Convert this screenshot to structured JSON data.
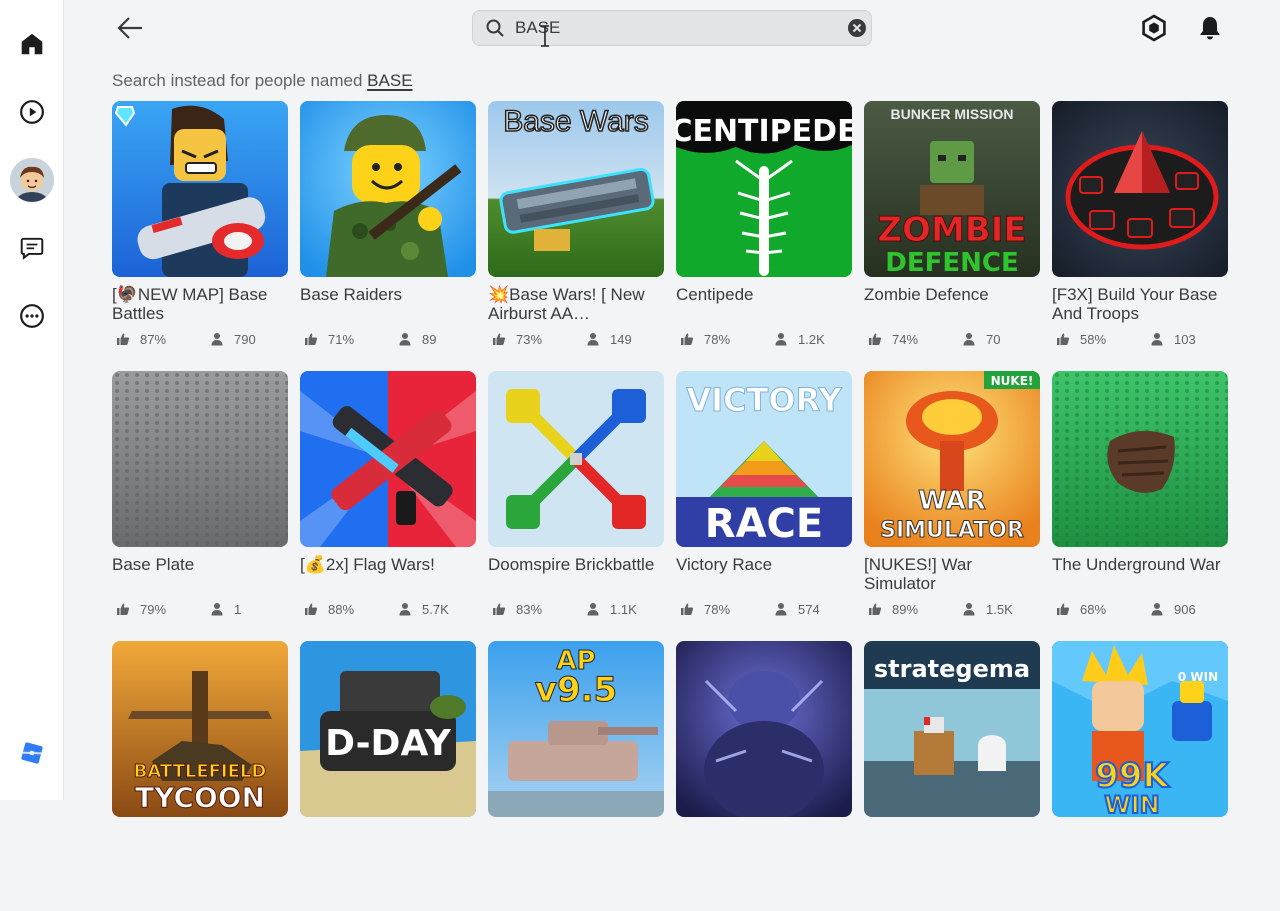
{
  "sidebar": {
    "items": [
      {
        "name": "home-icon"
      },
      {
        "name": "discover-icon"
      },
      {
        "name": "avatar"
      },
      {
        "name": "chat-icon"
      },
      {
        "name": "more-icon"
      }
    ],
    "logo": "roblox-logo"
  },
  "search": {
    "value": "BASE",
    "placeholder": "Search"
  },
  "suggestion": {
    "prefix": "Search instead for people named ",
    "name": "BASE"
  },
  "colors": {
    "accent": "#393b3d",
    "background": "#f2f4f5"
  },
  "games": [
    {
      "title": "[🦃NEW MAP] Base Battles",
      "rating": "87%",
      "players": "790"
    },
    {
      "title": "Base Raiders",
      "rating": "71%",
      "players": "89"
    },
    {
      "title": "💥Base Wars! [ New Airburst AA…",
      "rating": "73%",
      "players": "149"
    },
    {
      "title": "Centipede",
      "rating": "78%",
      "players": "1.2K"
    },
    {
      "title": "Zombie Defence",
      "rating": "74%",
      "players": "70"
    },
    {
      "title": "[F3X] Build Your Base And Troops",
      "rating": "58%",
      "players": "103"
    },
    {
      "title": "Base Plate",
      "rating": "79%",
      "players": "1"
    },
    {
      "title": "[💰2x] Flag Wars!",
      "rating": "88%",
      "players": "5.7K"
    },
    {
      "title": "Doomspire Brickbattle",
      "rating": "83%",
      "players": "1.1K"
    },
    {
      "title": "Victory Race",
      "rating": "78%",
      "players": "574"
    },
    {
      "title": "[NUKES!] War Simulator",
      "rating": "89%",
      "players": "1.5K"
    },
    {
      "title": "The Underground War",
      "rating": "68%",
      "players": "906"
    },
    {
      "title": "",
      "rating": "",
      "players": ""
    },
    {
      "title": "",
      "rating": "",
      "players": ""
    },
    {
      "title": "",
      "rating": "",
      "players": ""
    },
    {
      "title": "",
      "rating": "",
      "players": ""
    },
    {
      "title": "",
      "rating": "",
      "players": ""
    },
    {
      "title": "",
      "rating": "",
      "players": ""
    }
  ],
  "thumb_text": {
    "base_wars": "Base Wars",
    "centipede": "CENTIPEDE",
    "bunker": "BUNKER MISSION",
    "zombie": "ZOMBIE",
    "defence": "DEFENCE",
    "victory": "VICTORY",
    "race": "RACE",
    "nuke": "NUKE!",
    "war": "WAR",
    "simulator": "SIMULATOR",
    "battlefield": "BATTLEFIELD",
    "tycoon": "TYCOON",
    "dday": "D-DAY",
    "ap": "AP",
    "ap_version": "v9.5",
    "strategema": "strategema",
    "win_big": "99K",
    "win_small": "0 WIN",
    "win_word": "WIN"
  }
}
